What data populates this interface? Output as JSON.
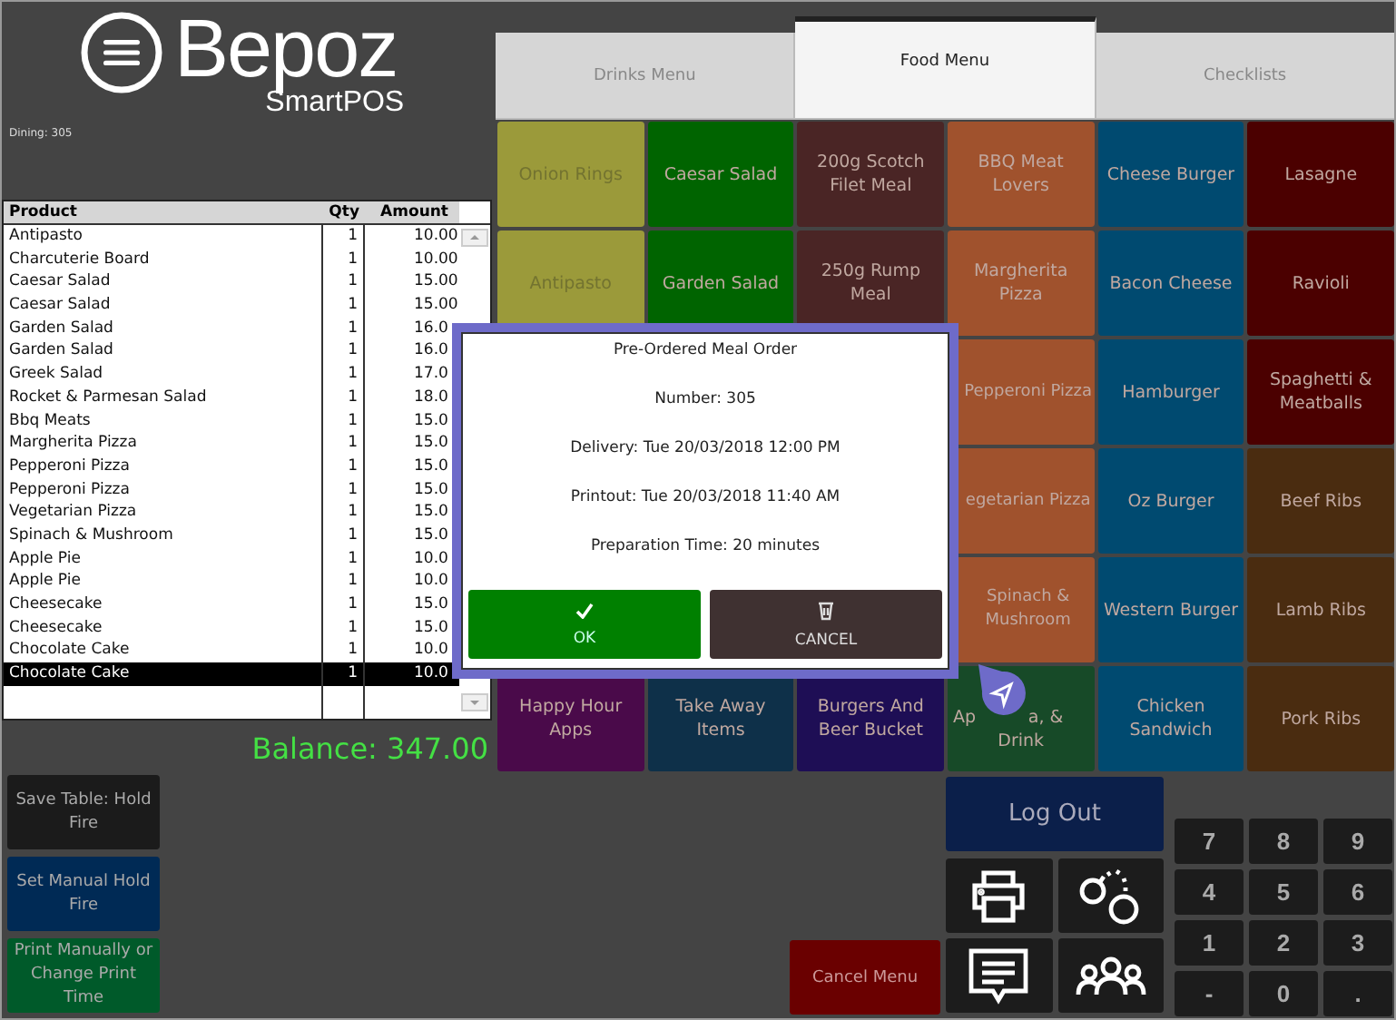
{
  "logo": {
    "name": "Bepoz",
    "product": "SmartPOS"
  },
  "table_label": "Dining: 305",
  "order": {
    "columns": [
      "Product",
      "Qty",
      "Amount"
    ],
    "rows": [
      {
        "product": "Antipasto",
        "qty": "1",
        "amount": "10.00",
        "selected": false
      },
      {
        "product": "Charcuterie Board",
        "qty": "1",
        "amount": "10.00",
        "selected": false
      },
      {
        "product": "Caesar Salad",
        "qty": "1",
        "amount": "15.00",
        "selected": false
      },
      {
        "product": "Caesar Salad",
        "qty": "1",
        "amount": "15.00",
        "selected": false
      },
      {
        "product": "Garden Salad",
        "qty": "1",
        "amount": "16.0",
        "selected": false
      },
      {
        "product": "Garden Salad",
        "qty": "1",
        "amount": "16.0",
        "selected": false
      },
      {
        "product": "Greek Salad",
        "qty": "1",
        "amount": "17.0",
        "selected": false
      },
      {
        "product": "Rocket & Parmesan Salad",
        "qty": "1",
        "amount": "18.0",
        "selected": false
      },
      {
        "product": "Bbq Meats",
        "qty": "1",
        "amount": "15.0",
        "selected": false
      },
      {
        "product": "Margherita Pizza",
        "qty": "1",
        "amount": "15.0",
        "selected": false
      },
      {
        "product": "Pepperoni Pizza",
        "qty": "1",
        "amount": "15.0",
        "selected": false
      },
      {
        "product": "Pepperoni Pizza",
        "qty": "1",
        "amount": "15.0",
        "selected": false
      },
      {
        "product": "Vegetarian Pizza",
        "qty": "1",
        "amount": "15.0",
        "selected": false
      },
      {
        "product": "Spinach & Mushroom",
        "qty": "1",
        "amount": "15.0",
        "selected": false
      },
      {
        "product": "Apple Pie",
        "qty": "1",
        "amount": "10.0",
        "selected": false
      },
      {
        "product": "Apple Pie",
        "qty": "1",
        "amount": "10.0",
        "selected": false
      },
      {
        "product": "Cheesecake",
        "qty": "1",
        "amount": "15.0",
        "selected": false
      },
      {
        "product": "Cheesecake",
        "qty": "1",
        "amount": "15.0",
        "selected": false
      },
      {
        "product": "Chocolate Cake",
        "qty": "1",
        "amount": "10.0",
        "selected": false
      },
      {
        "product": "Chocolate Cake",
        "qty": "1",
        "amount": "10.0",
        "selected": true
      }
    ]
  },
  "balance": "Balance: 347.00",
  "side_buttons": [
    {
      "label": "Save Table: Hold Fire",
      "color": "#1b1b1b"
    },
    {
      "label": "Set Manual Hold Fire",
      "color": "#002a55"
    },
    {
      "label": "Print Manually or Change Print Time",
      "color": "#005a2a"
    }
  ],
  "tabs": [
    {
      "label": "Drinks Menu",
      "selected": false
    },
    {
      "label": "Food Menu",
      "selected": true
    },
    {
      "label": "Checklists",
      "selected": false
    }
  ],
  "menu_grid": [
    [
      {
        "label": "Onion Rings",
        "color": "#9b9a3a"
      },
      {
        "label": "Caesar Salad",
        "color": "#006400"
      },
      {
        "label": "200g Scotch Filet Meal",
        "color": "#4a2525"
      },
      {
        "label": "BBQ Meat Lovers",
        "color": "#a0522d"
      },
      {
        "label": "Cheese Burger",
        "color": "#004a70"
      },
      {
        "label": "Lasagne",
        "color": "#4b0000"
      }
    ],
    [
      {
        "label": "Antipasto",
        "color": "#9b9a3a"
      },
      {
        "label": "Garden Salad",
        "color": "#006400"
      },
      {
        "label": "250g Rump Meal",
        "color": "#4a2525"
      },
      {
        "label": "Margherita Pizza",
        "color": "#a0522d"
      },
      {
        "label": "Bacon Cheese",
        "color": "#004a70"
      },
      {
        "label": "Ravioli",
        "color": "#4b0000"
      }
    ],
    [
      {
        "label": "Pepperoni Pizza",
        "color": "#a0522d"
      },
      {
        "label": "Hamburger",
        "color": "#004a70"
      },
      {
        "label": "Spaghetti & Meatballs",
        "color": "#4b0000"
      }
    ],
    [
      {
        "label": "egetarian Pizza",
        "color": "#a0522d"
      },
      {
        "label": "Oz Burger",
        "color": "#004a70"
      },
      {
        "label": "Beef Ribs",
        "color": "#4a2c10"
      }
    ],
    [
      {
        "label": "Spinach & Mushroom",
        "color": "#a0522d"
      },
      {
        "label": "Western Burger",
        "color": "#004a70"
      },
      {
        "label": "Lamb Ribs",
        "color": "#4a2c10"
      }
    ],
    [
      {
        "label": "Happy Hour Apps",
        "color": "#4a0a4a"
      },
      {
        "label": "Take Away Items",
        "color": "#0e3049"
      },
      {
        "label": "Burgers And Beer Bucket",
        "color": "#1e0e55"
      },
      {
        "label_parts": [
          "Ap",
          "a, &"
        ],
        "label": "Drink",
        "color": "#174a28"
      },
      {
        "label": "Chicken Sandwich",
        "color": "#004a70"
      },
      {
        "label": "Pork Ribs",
        "color": "#4a2c10"
      }
    ]
  ],
  "dialog": {
    "title": "Pre-Ordered Meal Order",
    "lines": [
      "Number: 305",
      "Delivery: Tue 20/03/2018 12:00 PM",
      "Printout: Tue 20/03/2018 11:40 AM",
      "Preparation Time: 20 minutes"
    ],
    "buttons": [
      {
        "label": "OK",
        "kind": "ok"
      },
      {
        "label": "CANCEL",
        "kind": "cancel"
      }
    ]
  },
  "cancel_menu": "Cancel Menu",
  "log_out": "Log Out",
  "function_buttons": [
    {
      "kind": "printer"
    },
    {
      "kind": "handcuffs"
    },
    {
      "kind": "message"
    },
    {
      "kind": "group"
    }
  ],
  "keypad": [
    "7",
    "8",
    "9",
    "4",
    "5",
    "6",
    "1",
    "2",
    "3",
    "-",
    "0",
    "."
  ]
}
